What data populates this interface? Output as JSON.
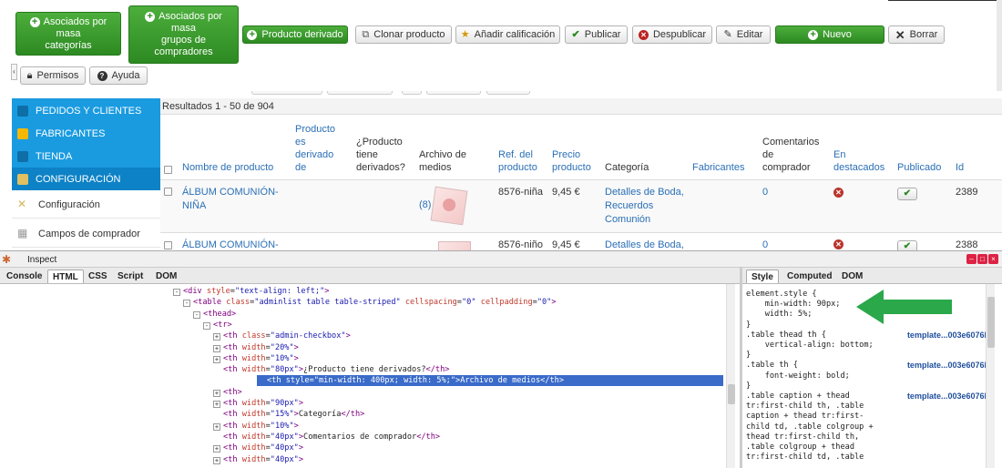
{
  "toolbar": {
    "btn_asociados_masa": "Asociados por masa categorías",
    "btn_asociados_masa_lines": [
      "Asociados por",
      "masa",
      "categorías"
    ],
    "btn_asociados_grupos_lines": [
      "Asociados por",
      "masa",
      "grupos de",
      "compradores"
    ],
    "btn_producto_derivado": "Producto derivado",
    "btn_clonar": "Clonar producto",
    "btn_calificacion": "Añadir calificación",
    "btn_publicar": "Publicar",
    "btn_despublicar": "Despublicar",
    "btn_editar": "Editar",
    "btn_nuevo": "Nuevo",
    "btn_borrar": "Borrar",
    "btn_permisos": "Permisos",
    "btn_ayuda": "Ayuda"
  },
  "sidebar": {
    "items": [
      {
        "label": "PEDIDOS Y CLIENTES",
        "icon": "orders-icon"
      },
      {
        "label": "FABRICANTES",
        "icon": "wrench-icon"
      },
      {
        "label": "TIENDA",
        "icon": "store-icon"
      },
      {
        "label": "CONFIGURACIÓN",
        "icon": "config-icon",
        "active": true
      }
    ],
    "subitems": [
      {
        "label": "Configuración",
        "icon": "tools-icon"
      },
      {
        "label": "Campos de comprador",
        "icon": "fields-icon"
      }
    ]
  },
  "table": {
    "results_text": "Resultados 1 - 50 de 904",
    "headers": {
      "nombre": "Nombre de producto",
      "es_derivado": [
        "Producto",
        "es",
        "derivado",
        "de"
      ],
      "tiene_derivados": [
        "¿Producto",
        "tiene",
        "derivados?"
      ],
      "archivo": [
        "Archivo de",
        "medios"
      ],
      "ref": [
        "Ref. del",
        "producto"
      ],
      "precio": [
        "Precio",
        "producto"
      ],
      "categoria": "Categoría",
      "fabricantes": "Fabricantes",
      "comentarios": [
        "Comentarios",
        "de",
        "comprador"
      ],
      "destacados": [
        "En",
        "destacados"
      ],
      "publicado": "Publicado",
      "id": "Id"
    },
    "rows": [
      {
        "name_lines": [
          "ÁLBUM COMUNIÓN-",
          "NIÑA"
        ],
        "media_count": "(8)",
        "ref": "8576-niña",
        "price": "9,45 €",
        "category_lines": [
          "Detalles de Boda,",
          "Recuerdos",
          "Comunión"
        ],
        "comments": "0",
        "featured": false,
        "published": true,
        "id": "2389"
      },
      {
        "name_lines": [
          "ÁLBUM COMUNIÓN-"
        ],
        "media_count": "",
        "ref": "8576-niño",
        "price": "9,45 €",
        "category_lines": [
          "Detalles de Boda,"
        ],
        "comments": "0",
        "featured": false,
        "published": true,
        "id": "2388"
      }
    ]
  },
  "inspector": {
    "title": "Inspect",
    "tabs": [
      "Console",
      "HTML",
      "CSS",
      "Script",
      "DOM"
    ],
    "active_tab": "HTML",
    "style_tabs": [
      "Style",
      "Computed",
      "DOM"
    ],
    "active_style_tab": "Style",
    "code_lines": [
      {
        "indent": 0,
        "html": "<span class='tw'>&lt;div</span> <span class='attr'>style</span>=<span class='val'>\"text-align: left;\"</span><span class='tw'>&gt;</span>",
        "exp": "-"
      },
      {
        "indent": 1,
        "html": "<span class='tw'>&lt;table</span> <span class='attr'>class</span>=<span class='val'>\"adminlist table table-striped\"</span> <span class='attr'>cellspacing</span>=<span class='val'>\"0\"</span> <span class='attr'>cellpadding</span>=<span class='val'>\"0\"</span><span class='tw'>&gt;</span>",
        "exp": "-"
      },
      {
        "indent": 2,
        "html": "<span class='tw'>&lt;thead&gt;</span>",
        "exp": "-"
      },
      {
        "indent": 3,
        "html": "<span class='tw'>&lt;tr&gt;</span>",
        "exp": "-"
      },
      {
        "indent": 4,
        "html": "<span class='tw'>&lt;th</span> <span class='attr'>class</span>=<span class='val'>\"admin-checkbox\"</span><span class='tw'>&gt;</span>",
        "exp": "+"
      },
      {
        "indent": 4,
        "html": "<span class='tw'>&lt;th</span> <span class='attr'>width</span>=<span class='val'>\"20%\"</span><span class='tw'>&gt;</span>",
        "exp": "+"
      },
      {
        "indent": 4,
        "html": "<span class='tw'>&lt;th</span> <span class='attr'>width</span>=<span class='val'>\"10%\"</span><span class='tw'>&gt;</span>",
        "exp": "+"
      },
      {
        "indent": 4,
        "html": "<span class='tw'>&lt;th</span> <span class='attr'>width</span>=<span class='val'>\"80px\"</span><span class='tw'>&gt;</span>¿Producto tiene derivados?<span class='tw'>&lt;/th&gt;</span>",
        "exp": ""
      },
      {
        "indent": 4,
        "html": "<span class='tw'>&lt;th</span> <span class='attr'>style</span>=<span class='val'>\"min-width: 400px; width: 5%;\"</span><span class='tw'>&gt;</span>Archivo de medios<span class='tw'>&lt;/th&gt;</span>",
        "exp": "",
        "selected": true
      },
      {
        "indent": 4,
        "html": "<span class='tw'>&lt;th&gt;</span>",
        "exp": "+"
      },
      {
        "indent": 4,
        "html": "<span class='tw'>&lt;th</span> <span class='attr'>width</span>=<span class='val'>\"90px\"</span><span class='tw'>&gt;</span>",
        "exp": "+"
      },
      {
        "indent": 4,
        "html": "<span class='tw'>&lt;th</span> <span class='attr'>width</span>=<span class='val'>\"15%\"</span><span class='tw'>&gt;</span>Categoría<span class='tw'>&lt;/th&gt;</span>",
        "exp": ""
      },
      {
        "indent": 4,
        "html": "<span class='tw'>&lt;th</span> <span class='attr'>width</span>=<span class='val'>\"10%\"</span><span class='tw'>&gt;</span>",
        "exp": "+"
      },
      {
        "indent": 4,
        "html": "<span class='tw'>&lt;th</span> <span class='attr'>width</span>=<span class='val'>\"40px\"</span><span class='tw'>&gt;</span>Comentarios de comprador<span class='tw'>&lt;/th&gt;</span>",
        "exp": ""
      },
      {
        "indent": 4,
        "html": "<span class='tw'>&lt;th</span> <span class='attr'>width</span>=<span class='val'>\"40px\"</span><span class='tw'>&gt;</span>",
        "exp": "+"
      },
      {
        "indent": 4,
        "html": "<span class='tw'>&lt;th</span> <span class='attr'>width</span>=<span class='val'>\"40px\"</span><span class='tw'>&gt;</span>",
        "exp": "+"
      }
    ],
    "style_lines": [
      {
        "text": "element.style {"
      },
      {
        "text": "    min-width: 90px;"
      },
      {
        "text": "    width: 5%;"
      },
      {
        "text": "}"
      },
      {
        "text": ".table thead th {",
        "src": "template...003e6076b"
      },
      {
        "text": "    vertical-align: bottom;"
      },
      {
        "text": "}"
      },
      {
        "text": ".table th {",
        "src": "template...003e6076b"
      },
      {
        "text": "    font-weight: bold;"
      },
      {
        "text": "}"
      },
      {
        "text": ".table caption + thead",
        "src": "template...003e6076b"
      },
      {
        "text": "tr:first-child th, .table"
      },
      {
        "text": "caption + thead tr:first-"
      },
      {
        "text": "child td, .table colgroup +"
      },
      {
        "text": "thead tr:first-child th,"
      },
      {
        "text": ".table colgroup + thead"
      },
      {
        "text": "tr:first-child td, .table"
      }
    ]
  },
  "colors": {
    "green": "#2d8a22",
    "sidebar_blue": "#1a9be0",
    "link_blue": "#2a6fb5",
    "selection": "#3a6bc9",
    "arrow_green": "#2aa84a"
  }
}
